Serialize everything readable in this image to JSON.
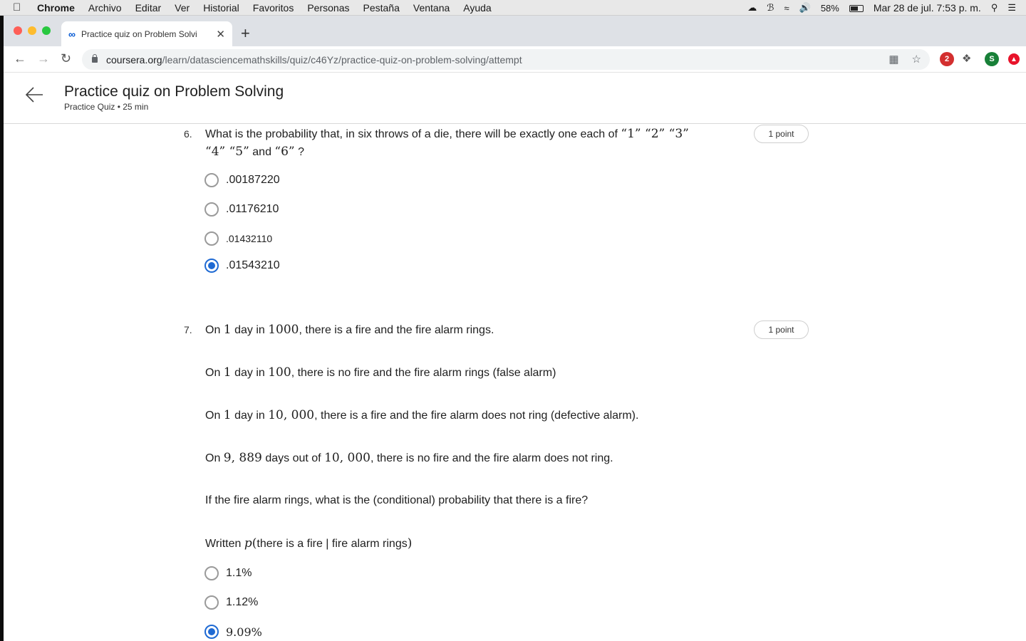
{
  "menubar": {
    "apple_icon": "apple-icon",
    "items": [
      "Chrome",
      "Archivo",
      "Editar",
      "Ver",
      "Historial",
      "Favoritos",
      "Personas",
      "Pestaña",
      "Ventana",
      "Ayuda"
    ],
    "battery": "58%",
    "datetime": "Mar 28 de jul.  7:53 p. m."
  },
  "browser": {
    "tab_title": "Practice quiz on Problem Solvi",
    "url_domain": "coursera.org",
    "url_path": "/learn/datasciencemathskills/quiz/c46Yz/practice-quiz-on-problem-solving/attempt",
    "ext_badge": "2",
    "profile_initial": "S"
  },
  "header": {
    "title": "Practice quiz on Problem Solving",
    "subtitle": "Practice Quiz • 25 min"
  },
  "questions": [
    {
      "number": "6.",
      "points": "1 point",
      "text_line1": "What is the probability that, in six throws of a die, there will be exactly one each of",
      "text_line1_math": "“1”  “2”  “3”",
      "text_line2_math": "“4”  “5”",
      "text_line2_mid": "and",
      "text_line2_math2": "“6”",
      "text_line2_end": "?",
      "options": [
        {
          "label": ".00187220",
          "selected": false
        },
        {
          "label": ".01176210",
          "selected": false
        },
        {
          "label": ".01432110",
          "selected": false
        },
        {
          "label": ".01543210",
          "selected": true
        }
      ]
    },
    {
      "number": "7.",
      "points": "1 point",
      "para1": {
        "a": "On",
        "n1": "1",
        "b": "day in",
        "n2": "1000",
        "c": ", there is a fire and the fire alarm rings."
      },
      "para2": {
        "a": "On",
        "n1": "1",
        "b": "day in",
        "n2": "100",
        "c": ", there is no fire and the fire alarm rings (false alarm)"
      },
      "para3": {
        "a": "On",
        "n1": "1",
        "b": "day in",
        "n2": "10, 000",
        "c": ", there is a fire and the fire alarm does not ring (defective alarm)."
      },
      "para4": {
        "a": "On",
        "n1": "9, 889",
        "b": "days out of",
        "n2": "10, 000",
        "c": ", there is no fire and the fire alarm does not ring."
      },
      "para5": "If the fire alarm rings, what is the (conditional) probability that there is a fire?",
      "para6": {
        "a": "Written",
        "p": "p",
        "paren_open": "(",
        "inner": "there is a fire | fire alarm rings",
        "paren_close": ")"
      },
      "options": [
        {
          "label": "1.1%",
          "selected": false
        },
        {
          "label": "1.12%",
          "selected": false
        },
        {
          "label": "9.09%",
          "selected": true
        }
      ]
    }
  ]
}
